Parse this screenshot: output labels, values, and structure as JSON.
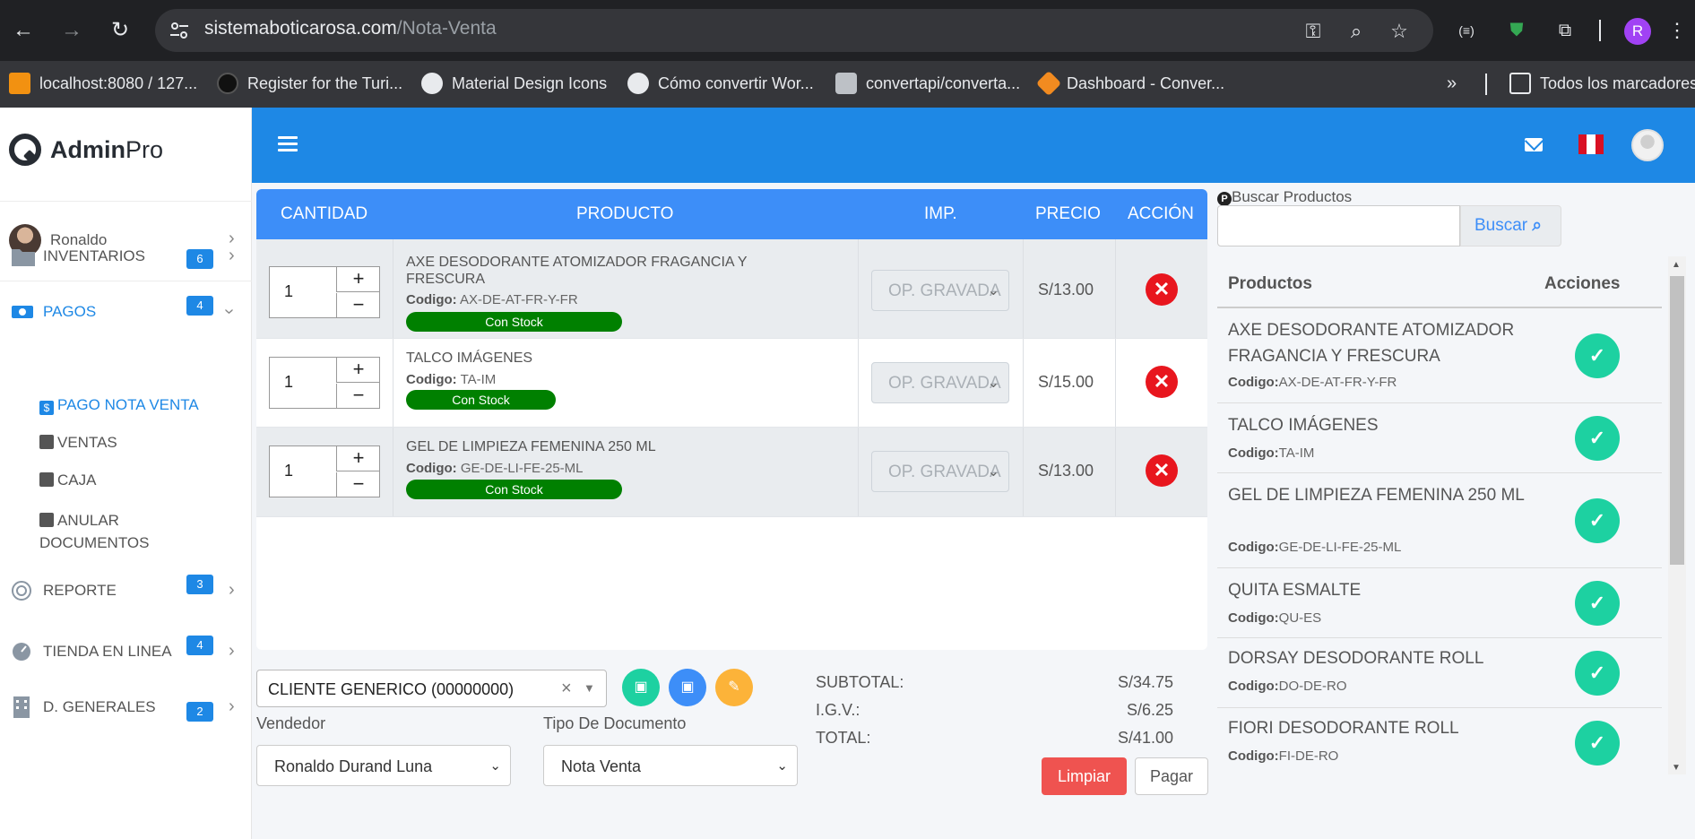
{
  "browser": {
    "url_domain": "sistemaboticarosa.com",
    "url_path": "/Nota-Venta",
    "profile_letter": "R",
    "bookmarks": [
      {
        "label": "localhost:8080 / 127...",
        "icon": "phpmyadmin-icon"
      },
      {
        "label": "Register for the Turi...",
        "icon": "github-icon"
      },
      {
        "label": "Material Design Icons",
        "icon": "globe-icon"
      },
      {
        "label": "Cómo convertir Wor...",
        "icon": "globe-icon"
      },
      {
        "label": "convertapi/converta...",
        "icon": "convertapi-icon"
      },
      {
        "label": "Dashboard - Conver...",
        "icon": "dashboard-icon"
      }
    ],
    "all_bookmarks_label": "Todos los marcadores"
  },
  "brand": {
    "bold": "Admin",
    "light": "Pro"
  },
  "sidebar": {
    "user_name": "Ronaldo",
    "items": [
      {
        "label": "INVENTARIOS",
        "badge": "6",
        "icon": "folder-icon"
      },
      {
        "label": "PAGOS",
        "badge": "4",
        "icon": "money-icon"
      },
      {
        "label": "REPORTE",
        "badge": "3",
        "icon": "target-icon"
      },
      {
        "label": "TIENDA EN LINEA",
        "badge": "4",
        "icon": "gauge-icon"
      },
      {
        "label": "D. GENERALES",
        "badge": "2",
        "icon": "building-icon"
      }
    ],
    "pagos_sub": [
      {
        "label": "PAGO NOTA VENTA",
        "icon": "dollar-icon"
      },
      {
        "label": "VENTAS",
        "icon": "docs-icon"
      },
      {
        "label": "CAJA",
        "icon": "register-icon"
      },
      {
        "label": "ANULAR",
        "label2": "DOCUMENTOS",
        "icon": "register-icon"
      }
    ]
  },
  "cart": {
    "headers": {
      "cantidad": "CANTIDAD",
      "producto": "PRODUCTO",
      "imp": "IMP.",
      "precio": "PRECIO",
      "accion": "ACCIÓN"
    },
    "code_label": "Codigo:",
    "rows": [
      {
        "qty": "1",
        "name": "AXE DESODORANTE ATOMIZADOR FRAGANCIA Y FRESCURA",
        "code": "AX-DE-AT-FR-Y-FR",
        "stock": "Con Stock",
        "imp": "OP. GRAVADA",
        "price": "S/13.00"
      },
      {
        "qty": "1",
        "name": "TALCO IMÁGENES",
        "code": "TA-IM",
        "stock": "Con Stock",
        "imp": "OP. GRAVADA",
        "price": "S/15.00"
      },
      {
        "qty": "1",
        "name": "GEL DE LIMPIEZA FEMENINA 250 ML",
        "code": "GE-DE-LI-FE-25-ML",
        "stock": "Con Stock",
        "imp": "OP. GRAVADA",
        "price": "S/13.00"
      }
    ],
    "plus": "+",
    "minus": "−"
  },
  "form": {
    "client": "CLIENTE GENERICO (00000000)",
    "vendedor_label": "Vendedor",
    "vendedor_value": "Ronaldo Durand Luna",
    "tipo_label": "Tipo De Documento",
    "tipo_value": "Nota Venta"
  },
  "totals": {
    "subtotal_label": "SUBTOTAL:",
    "subtotal": "S/34.75",
    "igv_label": "I.G.V.:",
    "igv": "S/6.25",
    "total_label": "TOTAL:",
    "total": "S/41.00"
  },
  "actions": {
    "clear": "Limpiar",
    "pay": "Pagar"
  },
  "search": {
    "label": "Buscar Productos",
    "button": "Buscar",
    "placeholder": ""
  },
  "product_list": {
    "header_products": "Productos",
    "header_actions": "Acciones",
    "code_label": "Codigo:",
    "items": [
      {
        "name": "AXE DESODORANTE ATOMIZADOR FRAGANCIA Y FRESCURA",
        "code": "AX-DE-AT-FR-Y-FR"
      },
      {
        "name": "TALCO IMÁGENES",
        "code": "TA-IM"
      },
      {
        "name": "GEL DE LIMPIEZA FEMENINA 250 ML",
        "code": "GE-DE-LI-FE-25-ML"
      },
      {
        "name": "QUITA ESMALTE",
        "code": "QU-ES"
      },
      {
        "name": "DORSAY DESODORANTE ROLL",
        "code": "DO-DE-RO"
      },
      {
        "name": "FIORI DESODORANTE ROLL",
        "code": "FI-DE-RO"
      }
    ]
  },
  "colors": {
    "topbar": "#1e88e5",
    "table_header": "#3d8ef8",
    "stock_badge": "#008000",
    "delete": "#e8161e",
    "add": "#1dd1a1",
    "clear_button": "#ef5350"
  }
}
